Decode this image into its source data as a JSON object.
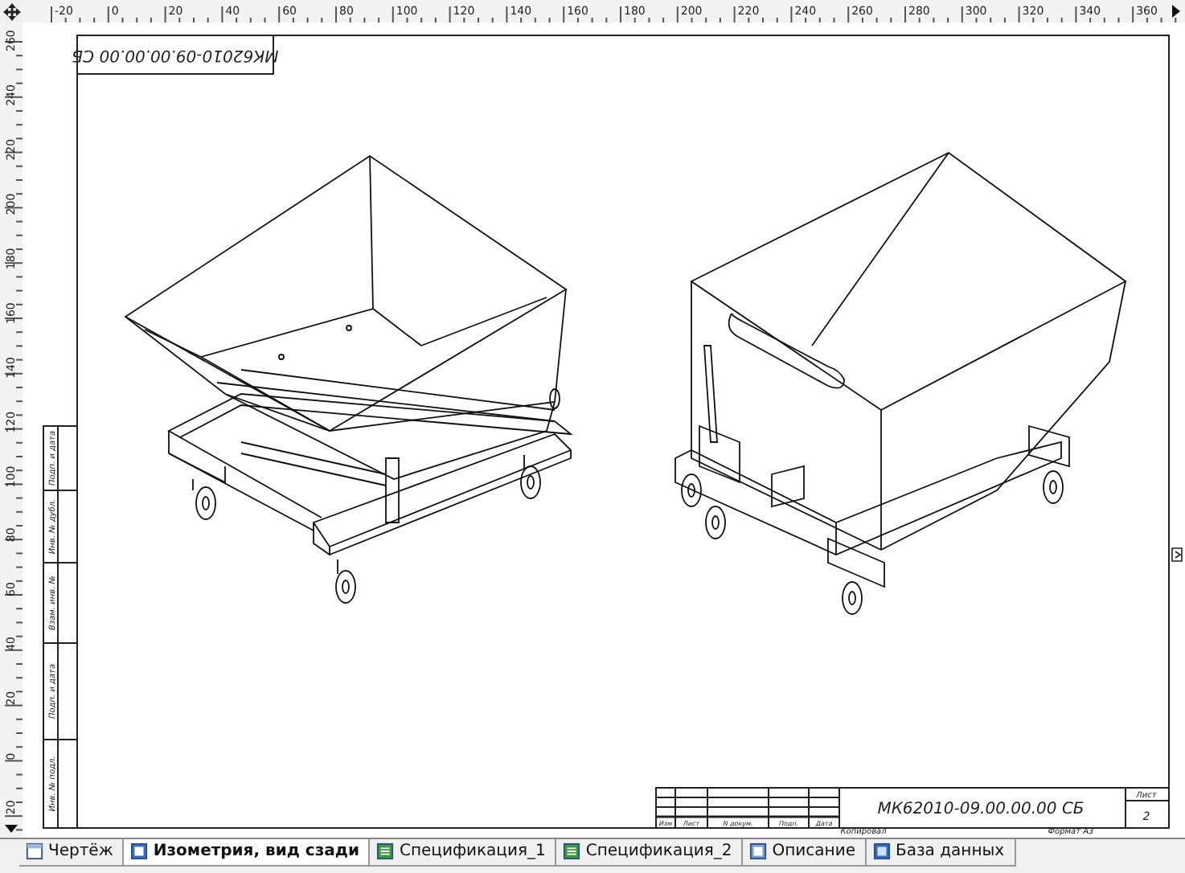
{
  "rulers": {
    "horizontal": [
      "-20",
      "0",
      "20",
      "40",
      "60",
      "80",
      "100",
      "120",
      "140",
      "160",
      "180",
      "200",
      "220",
      "240",
      "260",
      "280",
      "300",
      "320",
      "340",
      "360"
    ],
    "vertical": [
      "260",
      "240",
      "220",
      "200",
      "180",
      "160",
      "140",
      "120",
      "100",
      "80",
      "60",
      "40",
      "20",
      "0",
      "20"
    ]
  },
  "sheet": {
    "top_stamp": "МК62010-09.00.00.00 СБ",
    "side_stamp": [
      "Инв. № подл.",
      "Подп. и дата",
      "Взам. инв. №",
      "Инв. № дубл.",
      "Подп. и дата"
    ],
    "title_block": {
      "headers": [
        "Изм",
        "Лист",
        "N докум.",
        "Подп.",
        "Дата"
      ],
      "designation": "МК62010-09.00.00.00 СБ",
      "sheet_label": "Лист",
      "sheet_number": "2",
      "copied": "Копировал",
      "format": "Формат А3"
    }
  },
  "tabs": [
    {
      "label": "Чертёж",
      "kind": "sheet",
      "selected": false
    },
    {
      "label": "Изометрия, вид сзади",
      "kind": "view",
      "selected": true
    },
    {
      "label": "Спецификация_1",
      "kind": "spec",
      "selected": false
    },
    {
      "label": "Спецификация_2",
      "kind": "spec",
      "selected": false
    },
    {
      "label": "Описание",
      "kind": "text",
      "selected": false
    },
    {
      "label": "База данных",
      "kind": "database",
      "selected": false
    }
  ]
}
